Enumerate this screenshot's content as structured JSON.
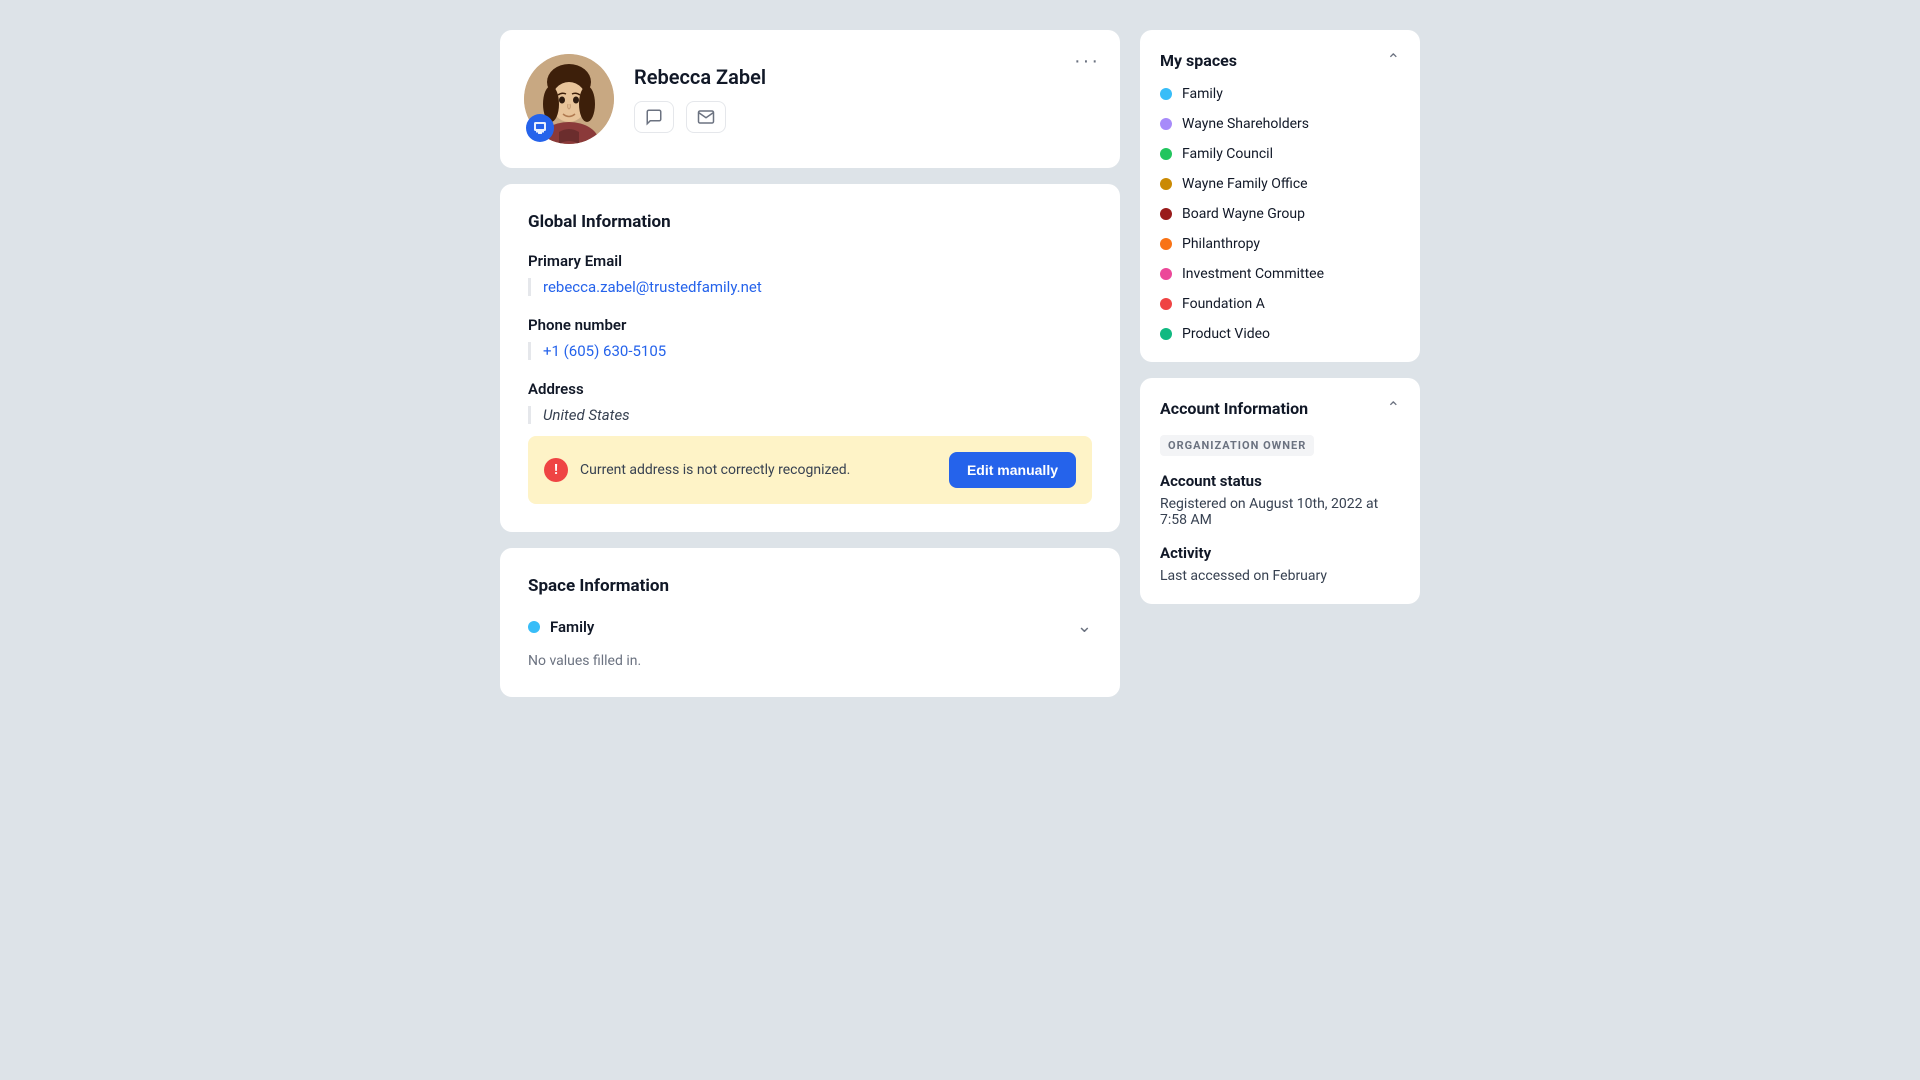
{
  "profile": {
    "name": "Rebecca Zabel",
    "more_label": "···",
    "comment_action": "comment",
    "email_action": "email",
    "avatar_bg": "#c8a882"
  },
  "global_info": {
    "section_title": "Global Information",
    "email_label": "Primary Email",
    "email_value": "rebecca.zabel@trustedfamily.net",
    "phone_label": "Phone number",
    "phone_value": "+1 (605) 630-5105",
    "address_label": "Address",
    "address_value": "United States",
    "warning_text": "Current address is not correctly recognized.",
    "edit_btn_label": "Edit manually"
  },
  "space_info": {
    "section_title": "Space Information",
    "space_name": "Family",
    "space_color": "#38bdf8",
    "no_values_text": "No values filled in."
  },
  "sidebar": {
    "my_spaces_title": "My spaces",
    "spaces": [
      {
        "name": "Family",
        "color": "#38bdf8"
      },
      {
        "name": "Wayne Shareholders",
        "color": "#a78bfa"
      },
      {
        "name": "Family Council",
        "color": "#22c55e"
      },
      {
        "name": "Wayne Family Office",
        "color": "#ca8a04"
      },
      {
        "name": "Board Wayne Group",
        "color": "#991b1b"
      },
      {
        "name": "Philanthropy",
        "color": "#f97316"
      },
      {
        "name": "Investment Committee",
        "color": "#ec4899"
      },
      {
        "name": "Foundation A",
        "color": "#ef4444"
      },
      {
        "name": "Product Video",
        "color": "#10b981"
      }
    ],
    "account_info_title": "Account Information",
    "org_badge": "ORGANIZATION OWNER",
    "account_status_label": "Account status",
    "account_status_value": "Registered on August 10th, 2022 at 7:58 AM",
    "activity_label": "Activity",
    "activity_value": "Last accessed on February"
  }
}
